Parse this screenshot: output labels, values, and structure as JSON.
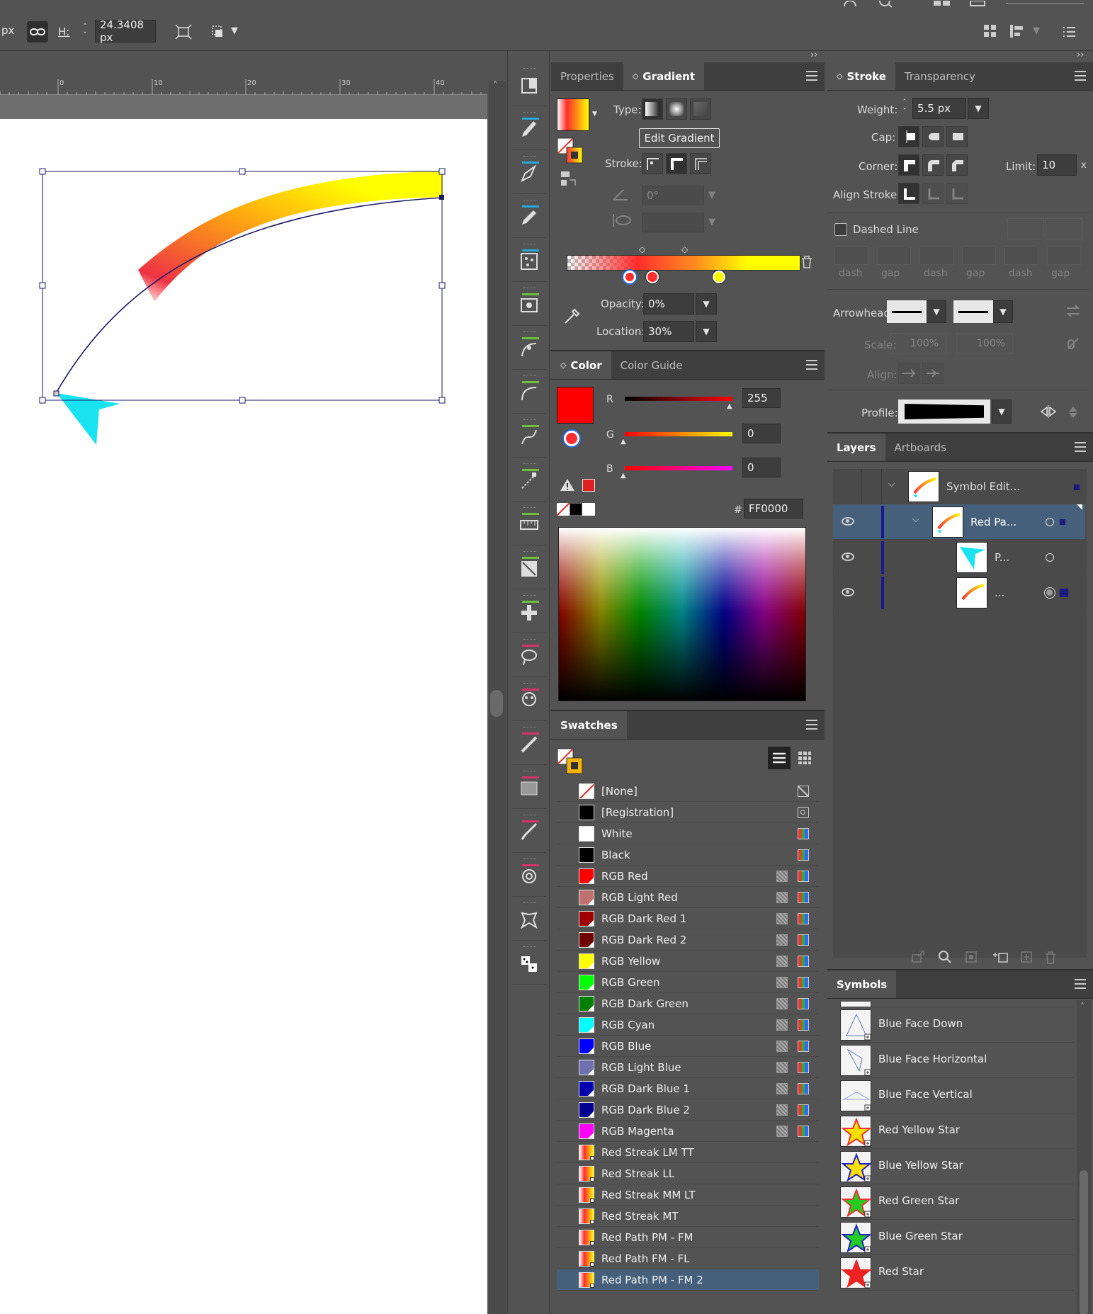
{
  "control_bar": {
    "w_unit_tail": "px",
    "h_label": "H:",
    "h_value": "24.3408 px"
  },
  "ruler": {
    "ticks": [
      "0",
      "10",
      "20",
      "30",
      "40"
    ]
  },
  "properties_tab": "Properties",
  "gradient": {
    "tab": "Gradient",
    "type_label": "Type:",
    "edit_button": "Edit Gradient",
    "stroke_label": "Stroke:",
    "angle_value": "0°",
    "opacity_label": "Opacity:",
    "opacity_value": "0%",
    "location_label": "Location:",
    "location_value": "30%"
  },
  "color": {
    "tab": "Color",
    "guide_tab": "Color Guide",
    "r_label": "R",
    "r_value": "255",
    "g_label": "G",
    "g_value": "0",
    "b_label": "B",
    "b_value": "0",
    "hash": "#",
    "hex_value": "FF0000",
    "fill_color": "#ff0000"
  },
  "swatches": {
    "tab": "Swatches",
    "items": [
      {
        "name": "[None]",
        "color": "none",
        "global": false
      },
      {
        "name": "[Registration]",
        "color": "#000000",
        "global": false
      },
      {
        "name": "White",
        "color": "#ffffff",
        "global": false
      },
      {
        "name": "Black",
        "color": "#000000",
        "global": false
      },
      {
        "name": "RGB Red",
        "color": "#ff0000",
        "global": true
      },
      {
        "name": "RGB Light Red",
        "color": "#c07070",
        "global": true
      },
      {
        "name": "RGB Dark Red 1",
        "color": "#a00000",
        "global": true
      },
      {
        "name": "RGB Dark Red 2",
        "color": "#700000",
        "global": true
      },
      {
        "name": "RGB Yellow",
        "color": "#ffff00",
        "global": true
      },
      {
        "name": "RGB Green",
        "color": "#00ff00",
        "global": true
      },
      {
        "name": "RGB Dark Green",
        "color": "#008000",
        "global": true
      },
      {
        "name": "RGB Cyan",
        "color": "#00ffff",
        "global": true
      },
      {
        "name": "RGB Blue",
        "color": "#0000ff",
        "global": true
      },
      {
        "name": "RGB Light Blue",
        "color": "#7070b0",
        "global": true
      },
      {
        "name": "RGB Dark Blue 1",
        "color": "#0000b0",
        "global": true
      },
      {
        "name": "RGB Dark Blue 2",
        "color": "#000090",
        "global": true
      },
      {
        "name": "RGB Magenta",
        "color": "#ff00ff",
        "global": true
      },
      {
        "name": "Red Streak LM TT",
        "color": "gradient",
        "global": false
      },
      {
        "name": "Red Streak LL",
        "color": "gradient",
        "global": false
      },
      {
        "name": "Red Streak MM LT",
        "color": "gradient",
        "global": false
      },
      {
        "name": "Red Streak MT",
        "color": "gradient",
        "global": false
      },
      {
        "name": "Red Path PM - FM",
        "color": "gradient",
        "global": false
      },
      {
        "name": "Red Path FM - FL",
        "color": "gradient",
        "global": false
      },
      {
        "name": "Red Path PM - FM 2",
        "color": "gradient",
        "global": false,
        "selected": true
      }
    ]
  },
  "stroke": {
    "tab": "Stroke",
    "transparency_tab": "Transparency",
    "weight_label": "Weight:",
    "weight_value": "5.5 px",
    "cap_label": "Cap:",
    "corner_label": "Corner:",
    "limit_label": "Limit:",
    "limit_value": "10",
    "limit_tail": "x",
    "align_label": "Align Stroke:",
    "dashed_label": "Dashed Line",
    "dash_labels": [
      "dash",
      "gap",
      "dash",
      "gap",
      "dash",
      "gap"
    ],
    "arrowheads_label": "Arrowheads:",
    "scale_label": "Scale:",
    "scale_a": "100%",
    "scale_b": "100%",
    "align_arrow_label": "Align:",
    "profile_label": "Profile:"
  },
  "layers": {
    "tab": "Layers",
    "artboards_tab": "Artboards",
    "rows": [
      {
        "name": "Symbol Edit..."
      },
      {
        "name": "Red Pa..."
      },
      {
        "name": "P..."
      },
      {
        "name": "..."
      }
    ]
  },
  "symbols": {
    "tab": "Symbols",
    "items": [
      {
        "name": "Blue Face Down"
      },
      {
        "name": "Blue Face Horizontal"
      },
      {
        "name": "Blue Face Vertical"
      },
      {
        "name": "Red Yellow Star"
      },
      {
        "name": "Blue Yellow Star"
      },
      {
        "name": "Red Green Star"
      },
      {
        "name": "Blue Green Star"
      },
      {
        "name": "Red Star"
      }
    ]
  }
}
